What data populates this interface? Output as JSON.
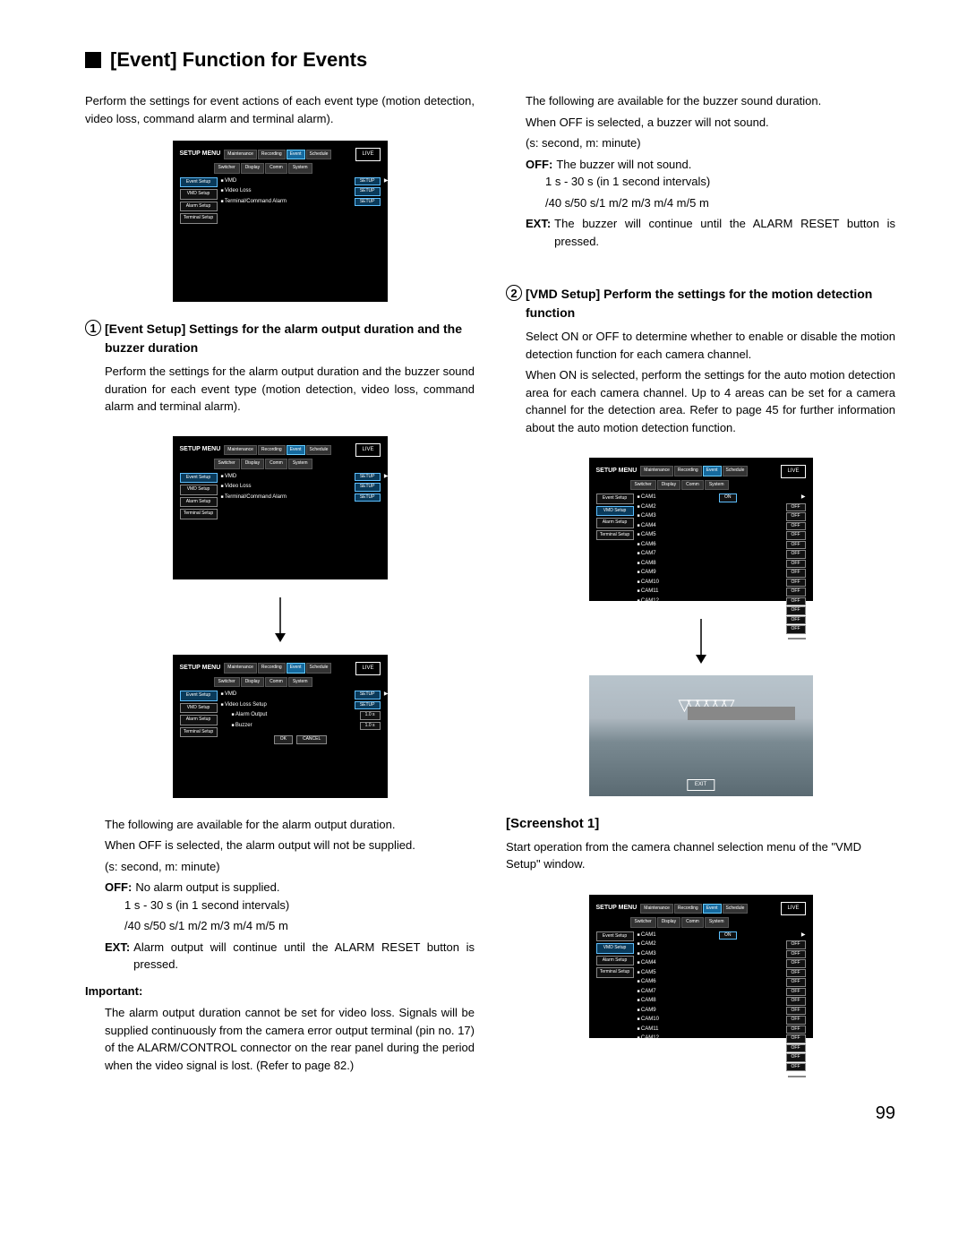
{
  "title": "[Event] Function for Events",
  "intro": "Perform the settings for event actions of each event type (motion detection, video loss, command alarm and terminal alarm).",
  "setup_menu": "SETUP MENU",
  "tabs": [
    "Maintenance",
    "Recording",
    "Event",
    "Schedule"
  ],
  "subtabs": [
    "Switcher",
    "Display",
    "Comm",
    "System"
  ],
  "live": "LIVE",
  "sidebar": [
    "Event Setup",
    "VMD Setup",
    "Alarm Setup",
    "Terminal Setup"
  ],
  "fig1_rows": [
    {
      "label": "VMD",
      "btn": "SETUP",
      "tri": true
    },
    {
      "label": "Video Loss",
      "btn": "SETUP"
    },
    {
      "label": "Terminal/Command Alarm",
      "btn": "SETUP"
    }
  ],
  "fig2_rows": [
    {
      "label": "VMD",
      "btn": "SETUP",
      "tri": true
    },
    {
      "label": "Video Loss",
      "btn": "SETUP"
    },
    {
      "label": "Terminal/Command Alarm",
      "btn": "SETUP"
    }
  ],
  "fig3_rows": [
    {
      "label": "VMD",
      "btn": "SETUP",
      "tri": true
    },
    {
      "label": "Video Loss Setup",
      "btn": "SETUP"
    }
  ],
  "fig3_sub": [
    {
      "label": "Alarm Output",
      "val": "1.0 s"
    },
    {
      "label": "Buzzer",
      "val": "1.0 s"
    }
  ],
  "ok": "OK",
  "cancel": "CANCEL",
  "cam_values": [
    "ON",
    "OFF",
    "OFF",
    "OFF",
    "OFF",
    "OFF",
    "OFF",
    "OFF",
    "OFF",
    "OFF",
    "OFF",
    "OFF",
    "OFF",
    "OFF",
    "OFF",
    ""
  ],
  "exit": "EXIT",
  "sect1": {
    "num": "1",
    "title": "[Event Setup] Settings for the alarm output duration and the buzzer duration",
    "p1": "Perform the settings for the alarm output duration and the buzzer sound duration for each event type (motion detection, video loss, command alarm and terminal alarm).",
    "p2": "The following are available for the alarm output duration.",
    "p3": "When OFF is selected, the alarm output will not be supplied.",
    "p4": "(s: second, m: minute)",
    "off_t": "OFF:",
    "off_d": "No alarm output is supplied.",
    "r1": "1 s - 30 s (in 1 second intervals)",
    "r2": "/40 s/50 s/1 m/2 m/3 m/4 m/5 m",
    "ext_t": "EXT:",
    "ext_d": "Alarm output will continue until the ALARM RESET button is pressed.",
    "imp": "Important:",
    "imp_p": "The alarm output duration cannot be set for video loss. Signals will be supplied continuously from the camera error output terminal (pin no. 17) of the ALARM/CONTROL connector on the rear panel during the period when the video signal is lost. (Refer to page 82.)"
  },
  "right": {
    "p1": "The following are available for the buzzer sound duration.",
    "p2": "When OFF is selected, a buzzer will not sound.",
    "p3": "(s: second, m: minute)",
    "off_t": "OFF:",
    "off_d": "The buzzer will not sound.",
    "r1": "1 s - 30 s (in 1 second intervals)",
    "r2": "/40 s/50 s/1 m/2 m/3 m/4 m/5 m",
    "ext_t": "EXT:",
    "ext_d": "The buzzer will continue until the ALARM RESET button is pressed."
  },
  "sect2": {
    "num": "2",
    "title": "[VMD Setup] Perform the settings for the motion detection function",
    "p1": "Select ON or OFF to determine whether to enable or disable the motion detection function for each camera channel.",
    "p2": "When ON is selected, perform the settings for the auto motion detection area for each camera channel. Up to 4 areas can be set for a camera channel for the detection area. Refer to page 45 for further information about the auto motion detection function."
  },
  "scr1_head": "[Screenshot 1]",
  "scr1_p": "Start operation from the camera channel selection menu of the \"VMD Setup\" window.",
  "page_num": "99"
}
